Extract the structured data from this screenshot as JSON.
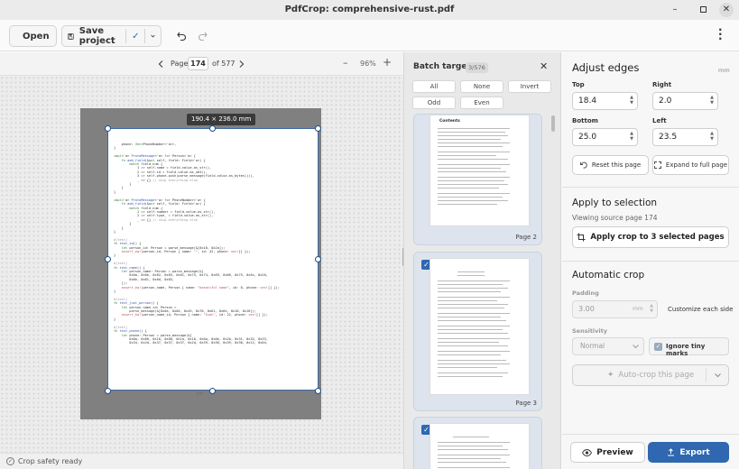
{
  "window": {
    "title": "PdfCrop: comprehensive-rust.pdf"
  },
  "header": {
    "open_label": "Open",
    "save_label": "Save project"
  },
  "doc_toolbar": {
    "page_label": "Page",
    "page_value": "174",
    "page_total": "of 577",
    "zoom": "96%"
  },
  "canvas": {
    "dimension_tooltip": "190.4 × 236.0 mm",
    "page_number": "174"
  },
  "status": {
    "text": "Crop safety ready"
  },
  "batch": {
    "title": "Batch targets",
    "count": "3/576",
    "filters": [
      "All",
      "None",
      "Invert",
      "Odd",
      "Even"
    ],
    "thumb_title": "Contents",
    "thumbs": [
      {
        "label": "Page 2",
        "checked": false
      },
      {
        "label": "Page 3",
        "checked": true
      },
      {
        "label": "",
        "checked": true
      }
    ]
  },
  "adjust": {
    "title": "Adjust edges",
    "unit": "mm",
    "top_label": "Top",
    "top_value": "18.4",
    "right_label": "Right",
    "right_value": "2.0",
    "bottom_label": "Bottom",
    "bottom_value": "25.0",
    "left_label": "Left",
    "left_value": "23.5",
    "reset_label": "Reset this page",
    "expand_label": "Expand to full page"
  },
  "apply": {
    "title": "Apply to selection",
    "subtitle": "Viewing source page 174",
    "button_label": "Apply crop to 3 selected pages"
  },
  "auto": {
    "title": "Automatic crop",
    "padding_label": "Padding",
    "padding_value": "3.00",
    "padding_unit": "mm",
    "customize_label": "Customize each side",
    "sensitivity_label": "Sensitivity",
    "sensitivity_value": "Normal",
    "ignore_label": "Ignore tiny marks",
    "autocrop_label": "Auto-crop this page"
  },
  "footer": {
    "preview_label": "Preview",
    "export_label": "Export"
  },
  "colors": {
    "accent": "#2f68b0",
    "crop_border": "#3b6aa8",
    "page_bg": "#808080"
  }
}
